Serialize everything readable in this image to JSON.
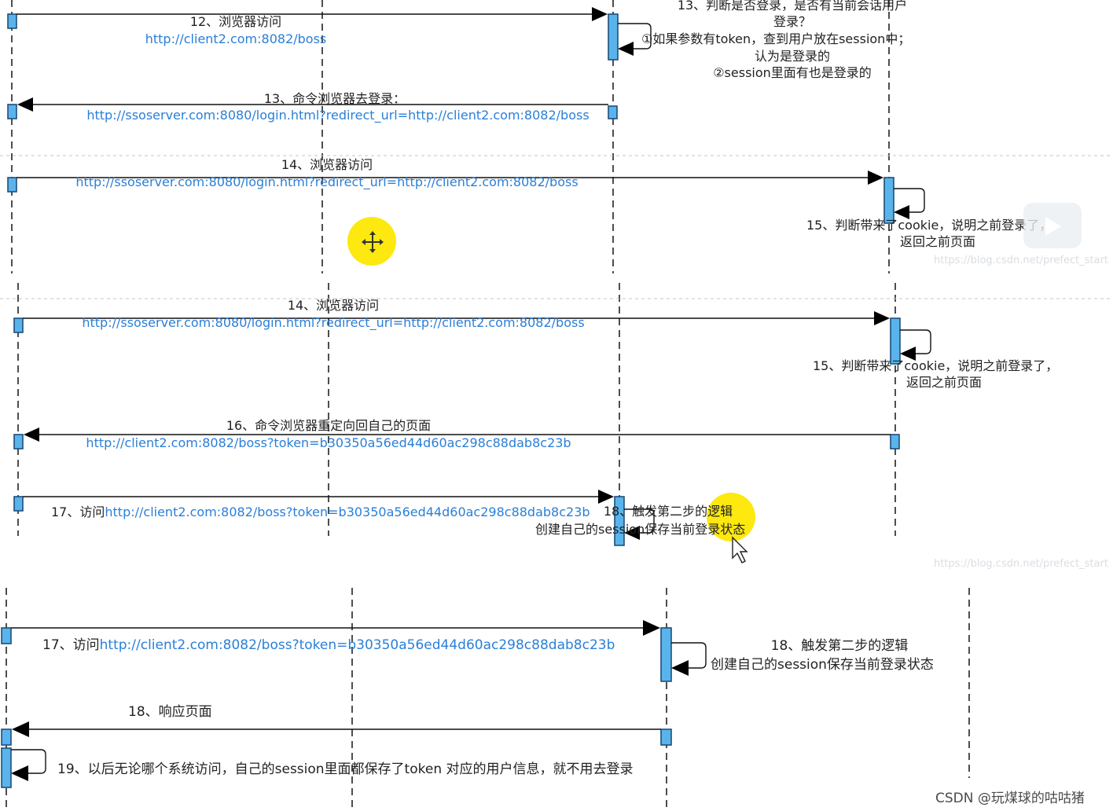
{
  "panel1": {
    "m12_title": "12、浏览器访问",
    "m12_url": "http://client2.com:8082/boss",
    "m13_note_line1": "13、判断是否登录，是否有当前会话用户",
    "m13_note_line2": "登录？",
    "m13_note_line3": "①如果参数有token，查到用户放在session中；",
    "m13_note_line4": "认为是登录的",
    "m13_note_line5": "②session里面有也是登录的",
    "m13_title": "13、命令浏览器去登录：",
    "m13_url": "http://ssoserver.com:8080/login.html?redirect_url=http://client2.com:8082/boss",
    "m14_title": "14、浏览器访问",
    "m14_url": "http://ssoserver.com:8080/login.html?redirect_url=http://client2.com:8082/boss",
    "m15_line1": "15、判断带来了cookie，说明之前登录了，",
    "m15_line2": "返回之前页面",
    "watermark": "https://blog.csdn.net/prefect_start"
  },
  "panel2": {
    "m14_title": "14、浏览器访问",
    "m14_url": "http://ssoserver.com:8080/login.html?redirect_url=http://client2.com:8082/boss",
    "m15_line1": "15、判断带来了cookie，说明之前登录了，",
    "m15_line2": "返回之前页面",
    "m16_title": "16、命令浏览器重定向回自己的页面",
    "m16_url": "http://client2.com:8082/boss?token=b30350a56ed44d60ac298c88dab8c23b",
    "m17_prefix": "17、访问",
    "m17_url": "http://client2.com:8082/boss?token=b30350a56ed44d60ac298c88dab8c23b",
    "m18_line1": "18、触发第二步的逻辑",
    "m18_line2": "创建自己的session保存当前登录状态",
    "watermark": "https://blog.csdn.net/prefect_start"
  },
  "panel3": {
    "m17_prefix": "17、访问",
    "m17_url": "http://client2.com:8082/boss?token=b30350a56ed44d60ac298c88dab8c23b",
    "m18_line1": "18、触发第二步的逻辑",
    "m18_line2": "创建自己的session保存当前登录状态",
    "m18b_title": "18、响应页面",
    "m19_text": "19、以后无论哪个系统访问，自己的session里面都保存了token 对应的用户信息，就不用去登录"
  },
  "overlays": {
    "move_cursor_icon": "move-arrows-icon",
    "pointer_cursor_icon": "mouse-pointer-icon",
    "video_icon": "play-icon"
  },
  "footer": {
    "credit": "CSDN @玩煤球的咕咕猪"
  },
  "colors": {
    "activation": "#5ab4ec",
    "url_text": "#2a7fd8",
    "highlight": "#fde80f"
  }
}
